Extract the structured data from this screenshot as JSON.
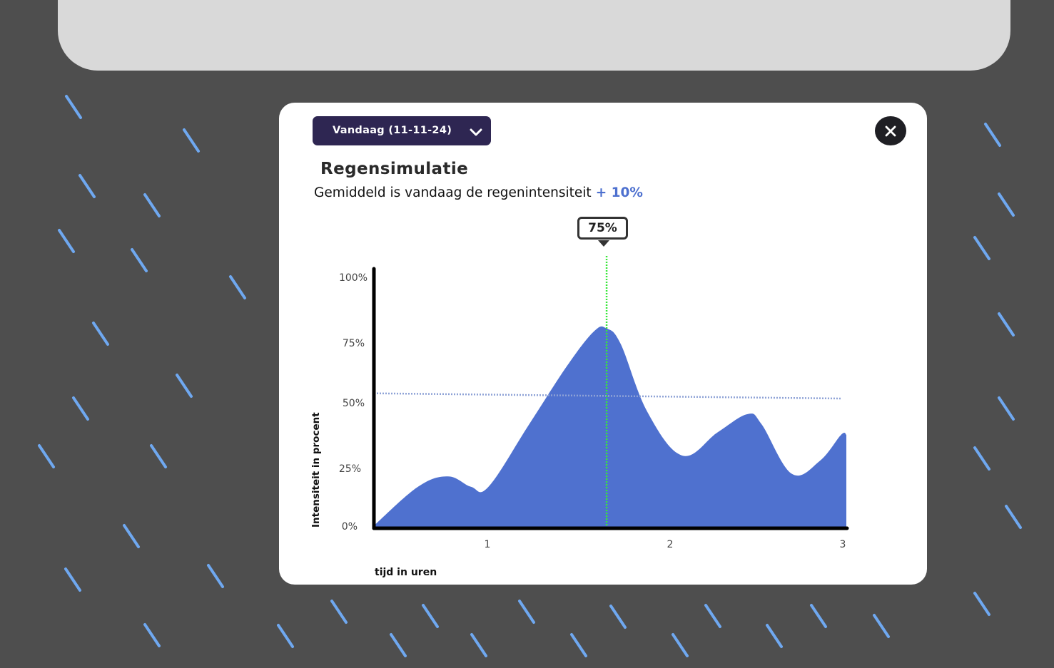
{
  "colors": {
    "background": "#4e4e4e",
    "top_panel": "#d9d9d9",
    "rain": "#6fa8f0",
    "modal": "#ffffff",
    "select": "#2e2652",
    "close": "#1f1f24",
    "area": "#4f71cf",
    "average_line": "#8ea2d6",
    "marker": "#39e639",
    "accent": "#4d70cf"
  },
  "date_select": {
    "selected": "Vandaag (11-11-24)",
    "icon": "chevron-down-icon"
  },
  "close_button": {
    "icon": "close-icon"
  },
  "header": {
    "title": "Regensimulatie",
    "subtitle_text": "Gemiddeld is vandaag de regenintensiteit",
    "subtitle_delta": "+ 10%"
  },
  "chart_data": {
    "type": "area",
    "xlabel": "tijd in uren",
    "ylabel": "Intensiteit in procent",
    "x_ticks": [
      "1",
      "2",
      "3"
    ],
    "y_ticks": [
      "0%",
      "25%",
      "50%",
      "75%",
      "100%"
    ],
    "xlim": [
      0.35,
      3.03
    ],
    "ylim": [
      0,
      100
    ],
    "grid": false,
    "series": [
      {
        "x": [
          0.35,
          0.6,
          0.77,
          0.9,
          1.0,
          1.23,
          1.45,
          1.6,
          1.67,
          1.75,
          1.9,
          2.1,
          2.3,
          2.47,
          2.55,
          2.72,
          2.88,
          3.0,
          3.03
        ],
        "y": [
          1,
          16,
          20,
          16,
          16,
          40,
          63,
          76,
          77,
          71,
          45,
          28,
          37,
          44,
          40,
          21,
          26,
          36,
          36
        ]
      }
    ],
    "average_line": {
      "y": [
        52,
        50
      ]
    },
    "marker": {
      "x": 1.67,
      "label": "75%"
    }
  }
}
